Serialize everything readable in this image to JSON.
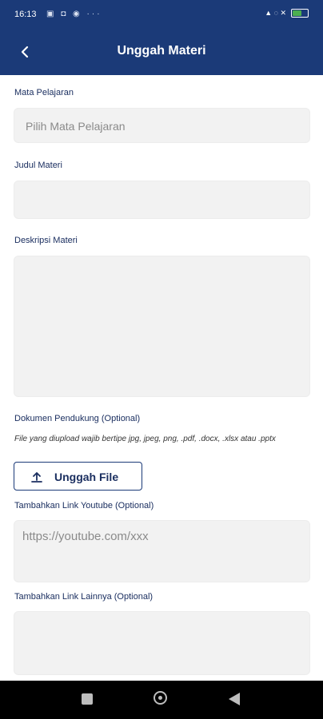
{
  "status_bar": {
    "time": "16:13",
    "left_icons": "▣ ◘ ◉ ···",
    "right_icons": "▲ ◌ ✕"
  },
  "header": {
    "title": "Unggah Materi",
    "back_icon": "arrow-back-icon"
  },
  "form": {
    "subject": {
      "label": "Mata Pelajaran",
      "placeholder": "Pilih Mata Pelajaran"
    },
    "title_field": {
      "label": "Judul Materi",
      "value": ""
    },
    "description": {
      "label": "Deskripsi Materi",
      "value": ""
    },
    "documents": {
      "label": "Dokumen Pendukung (Optional)",
      "note": "File yang diupload wajib bertipe jpg, jpeg, png, .pdf, .docx, .xlsx atau .pptx",
      "upload_label": "Unggah File",
      "upload_icon": "upload-icon"
    },
    "youtube": {
      "label": "Tambahkan Link Youtube (Optional)",
      "placeholder": "https://youtube.com/xxx"
    },
    "other_link": {
      "label": "Tambahkan Link Lainnya (Optional)",
      "value": ""
    }
  },
  "nav_bar": {
    "recents_icon": "square-icon",
    "home_icon": "circle-icon",
    "back_icon": "triangle-back-icon"
  },
  "colors": {
    "primary": "#1b3a78",
    "field_bg": "#f2f2f2",
    "label": "#1b2f60"
  }
}
